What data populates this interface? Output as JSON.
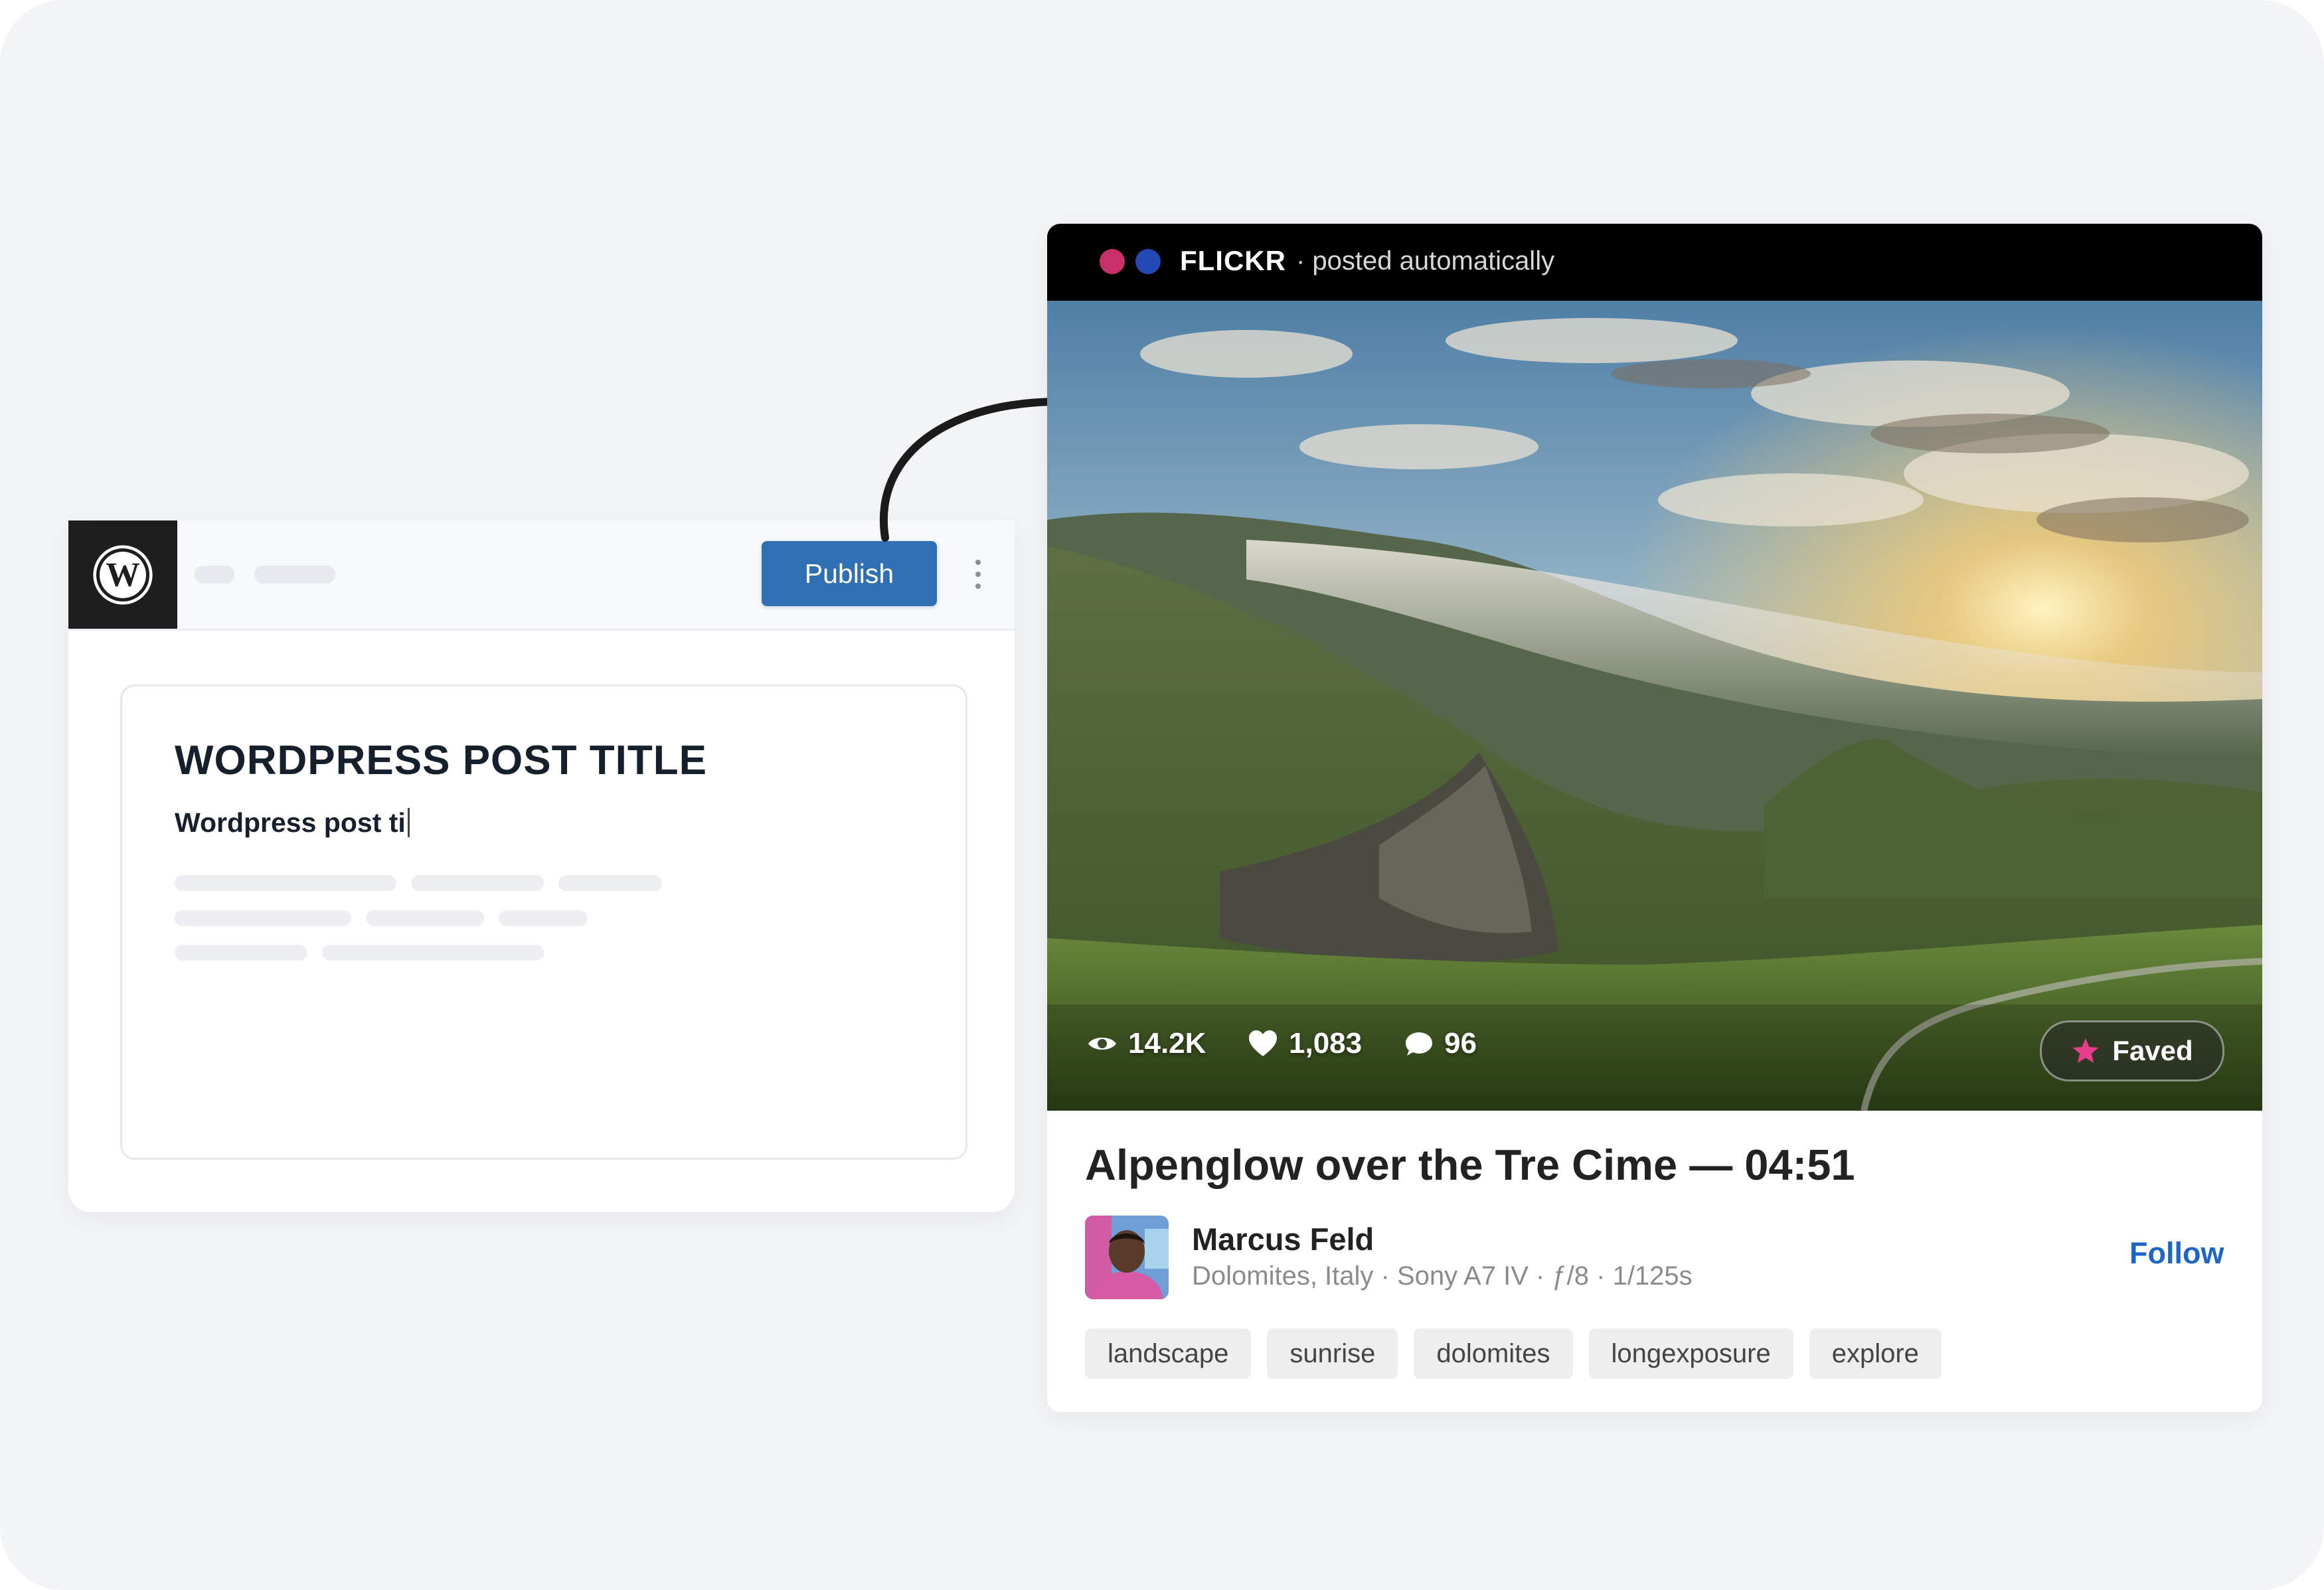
{
  "wordpress": {
    "publish_label": "Publish",
    "post_title": "WORDPRESS POST TITLE",
    "post_body_typed": "Wordpress post ti"
  },
  "flickr": {
    "brand": "FLICKR",
    "subtitle": "· posted automatically",
    "dot_colors": [
      "#c8306a",
      "#2448b4"
    ],
    "photo_title": "Alpenglow over the Tre Cime — 04:51",
    "stats": {
      "views": "14.2K",
      "likes": "1,083",
      "comments": "96"
    },
    "faved_label": "Faved",
    "author_name": "Marcus Feld",
    "meta": "Dolomites, Italy · Sony A7 IV · ƒ/8 · 1/125s",
    "follow_label": "Follow",
    "tags": [
      "landscape",
      "sunrise",
      "dolomites",
      "longexposure",
      "explore"
    ]
  },
  "colors": {
    "publish_blue": "#2f6fb4",
    "follow_blue": "#1d66c8",
    "faved_star": "#e83c8c"
  }
}
